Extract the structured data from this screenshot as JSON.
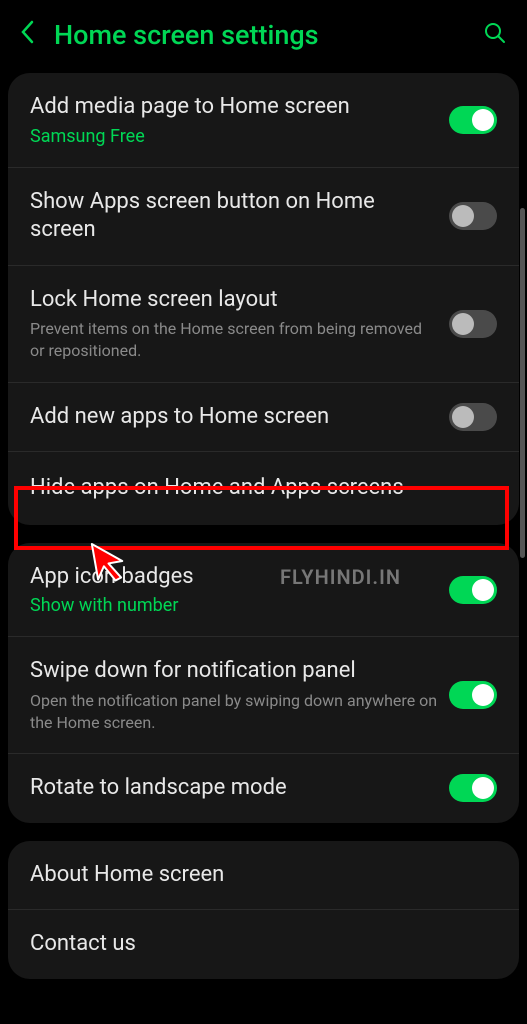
{
  "header": {
    "title": "Home screen settings"
  },
  "sections": [
    {
      "rows": [
        {
          "title": "Add media page to Home screen",
          "subtitle": "Samsung Free",
          "subtitleStyle": "green",
          "toggle": true
        },
        {
          "title": "Show Apps screen button on Home screen",
          "toggle": false
        },
        {
          "title": "Lock Home screen layout",
          "subtitle": "Prevent items on the Home screen from being removed or repositioned.",
          "subtitleStyle": "gray",
          "toggle": false
        },
        {
          "title": "Add new apps to Home screen",
          "toggle": false
        },
        {
          "title": "Hide apps on Home and Apps screens",
          "highlighted": true
        }
      ]
    },
    {
      "rows": [
        {
          "title": "App icon badges",
          "subtitle": "Show with number",
          "subtitleStyle": "green",
          "toggle": true
        },
        {
          "title": "Swipe down for notification panel",
          "subtitle": "Open the notification panel by swiping down anywhere on the Home screen.",
          "subtitleStyle": "gray",
          "toggle": true
        },
        {
          "title": "Rotate to landscape mode",
          "toggle": true
        }
      ]
    },
    {
      "rows": [
        {
          "title": "About Home screen"
        },
        {
          "title": "Contact us"
        }
      ]
    }
  ],
  "watermark": "FLYHINDI.IN"
}
